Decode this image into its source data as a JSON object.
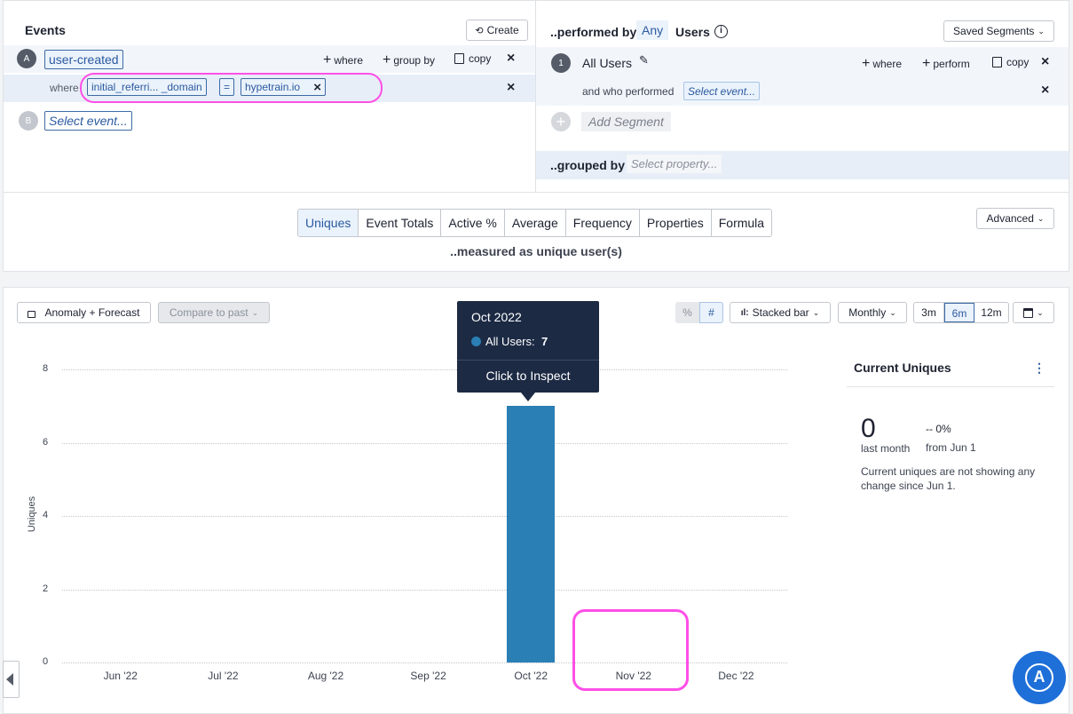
{
  "events": {
    "header": "Events",
    "create_label": "Create",
    "event_a": {
      "letter": "A",
      "name": "user-created"
    },
    "actions": {
      "where": "where",
      "group_by": "group by",
      "copy": "copy"
    },
    "filter": {
      "where_label": "where",
      "property": "initial_referri... _domain",
      "operator": "=",
      "value": "hypetrain.io"
    },
    "event_b": {
      "letter": "B",
      "placeholder": "Select event..."
    }
  },
  "segments": {
    "performed_by": "..performed by",
    "any_label": "Any",
    "users_label": "Users",
    "saved_segments_label": "Saved Segments",
    "segment_1": {
      "number": "1",
      "name": "All Users"
    },
    "actions": {
      "where": "where",
      "perform": "perform",
      "copy": "copy"
    },
    "and_who_performed": "and who performed",
    "select_event": "Select event...",
    "add_segment": "Add Segment",
    "grouped_by": "..grouped by",
    "select_property": "Select property..."
  },
  "measure": {
    "tabs": [
      "Uniques",
      "Event Totals",
      "Active %",
      "Average",
      "Frequency",
      "Properties",
      "Formula"
    ],
    "active_tab": "Uniques",
    "caption": "..measured as unique user(s)",
    "advanced_label": "Advanced"
  },
  "chart_controls": {
    "anomaly_label": "Anomaly + Forecast",
    "compare_label": "Compare to past",
    "percent_label": "%",
    "count_label": "#",
    "chart_type_label": "Stacked bar",
    "interval_label": "Monthly",
    "ranges": [
      "3m",
      "6m",
      "12m"
    ],
    "active_range": "6m"
  },
  "tooltip": {
    "title": "Oct 2022",
    "series_label": "All Users:",
    "series_value": "7",
    "inspect_label": "Click to Inspect"
  },
  "summary": {
    "title": "Current Uniques",
    "value": "0",
    "value_caption": "last month",
    "change": "-- 0%",
    "change_caption": "from Jun 1",
    "note": "Current uniques are not showing any change since Jun 1."
  },
  "colors": {
    "accent": "#2b5aa0",
    "bar": "#2a7fb5",
    "tooltip_bg": "#1c2a44",
    "highlight": "#ff4fe7"
  },
  "chart_data": {
    "type": "bar",
    "categories": [
      "Jun '22",
      "Jul '22",
      "Aug '22",
      "Sep '22",
      "Oct '22",
      "Nov '22",
      "Dec '22"
    ],
    "series": [
      {
        "name": "All Users",
        "values": [
          0,
          0,
          0,
          0,
          7,
          0,
          0
        ]
      }
    ],
    "ylabel": "Uniques",
    "yticks": [
      0,
      2,
      4,
      6,
      8
    ],
    "ylim": [
      0,
      8
    ],
    "grid": true
  }
}
